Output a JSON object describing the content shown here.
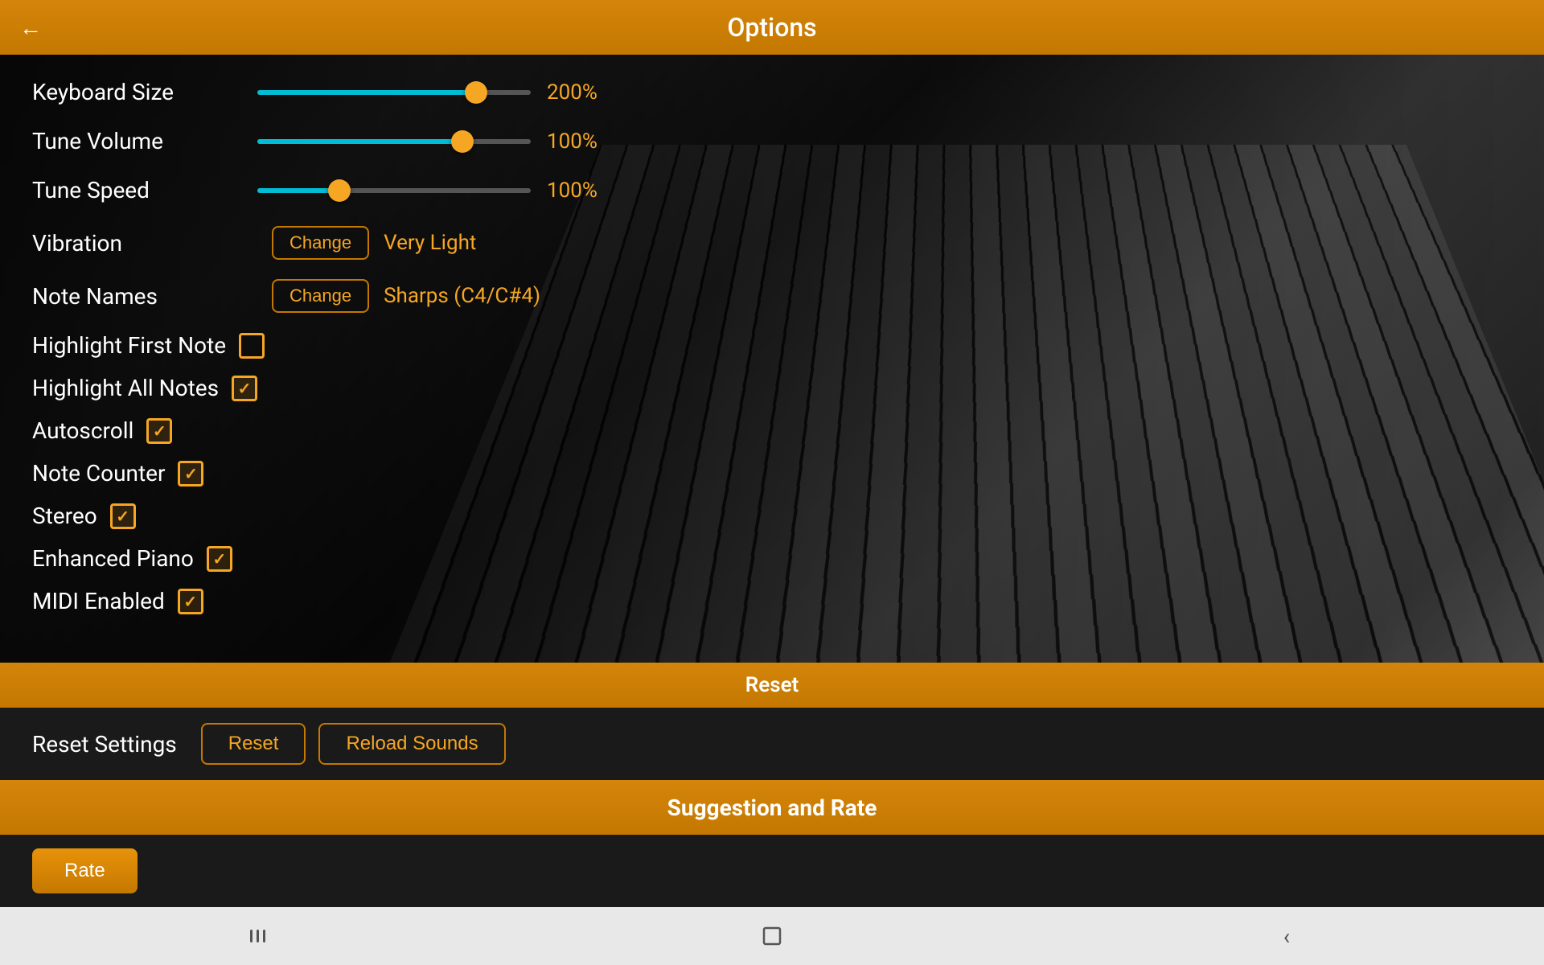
{
  "header": {
    "title": "Options",
    "back_icon": "←"
  },
  "sliders": {
    "keyboard_size": {
      "label": "Keyboard Size",
      "value": "200%",
      "fill_percent": 80,
      "thumb_percent": 80
    },
    "tune_volume": {
      "label": "Tune Volume",
      "value": "100%",
      "fill_percent": 75,
      "thumb_percent": 75
    },
    "tune_speed": {
      "label": "Tune Speed",
      "value": "100%",
      "fill_percent": 30,
      "thumb_percent": 30
    }
  },
  "vibration": {
    "label": "Vibration",
    "button": "Change",
    "value": "Very Light"
  },
  "note_names": {
    "label": "Note Names",
    "button": "Change",
    "value": "Sharps (C4/C#4)"
  },
  "checkboxes": [
    {
      "id": "highlight_first",
      "label": "Highlight First Note",
      "checked": false
    },
    {
      "id": "highlight_all",
      "label": "Highlight All Notes",
      "checked": true
    },
    {
      "id": "autoscroll",
      "label": "Autoscroll",
      "checked": true
    },
    {
      "id": "note_counter",
      "label": "Note Counter",
      "checked": true
    },
    {
      "id": "stereo",
      "label": "Stereo",
      "checked": true
    },
    {
      "id": "enhanced_piano",
      "label": "Enhanced Piano",
      "checked": true
    },
    {
      "id": "midi_enabled",
      "label": "MIDI Enabled",
      "checked": true
    }
  ],
  "reset_section": {
    "header": "Reset",
    "label": "Reset Settings",
    "reset_btn": "Reset",
    "reload_btn": "Reload Sounds"
  },
  "suggestion_section": {
    "header": "Suggestion and Rate",
    "button_label": "Rate"
  },
  "nav": {
    "back_icon": "‹"
  }
}
